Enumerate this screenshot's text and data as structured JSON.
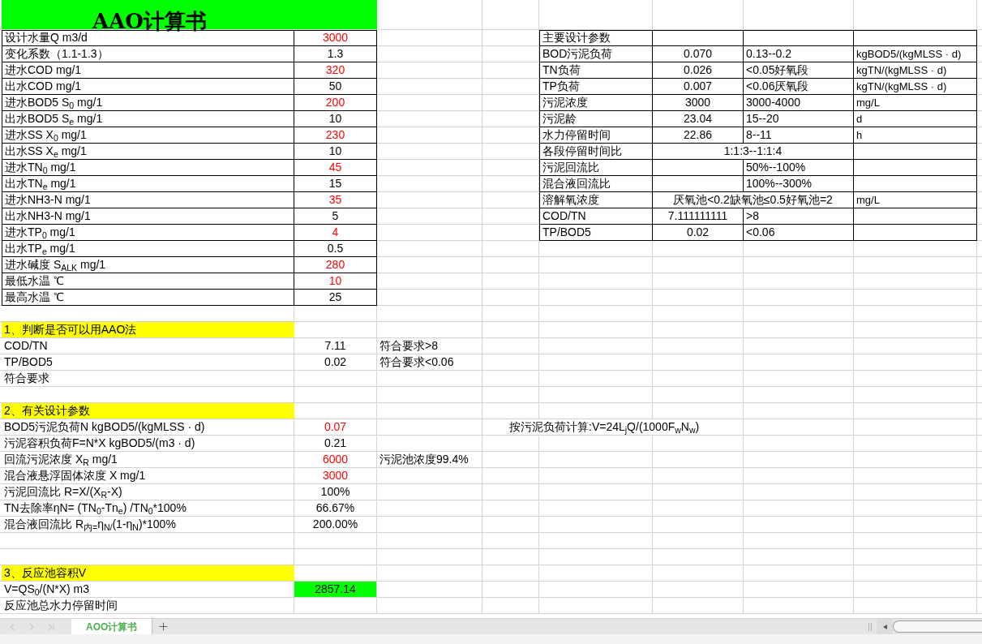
{
  "title": "AAO计算书",
  "input_table": [
    {
      "label": "设计水量Q m3/d",
      "value": "3000",
      "color": "#ff0000"
    },
    {
      "label": "变化系数（1.1-1.3）",
      "value": "1.3",
      "color": "#000000"
    },
    {
      "label": "进水COD mg/1",
      "value": "320",
      "color": "#ff0000"
    },
    {
      "label": "出水COD mg/1",
      "value": "50",
      "color": "#000000"
    },
    {
      "label": "进水BOD5 S$_{0}$ mg/1",
      "value": "200",
      "color": "#ff0000"
    },
    {
      "label": "出水BOD5 S$_{e}$ mg/1",
      "value": "10",
      "color": "#000000"
    },
    {
      "label": "进水SS X$_{0}$ mg/1",
      "value": "230",
      "color": "#ff0000"
    },
    {
      "label": "出水SS X$_{e}$ mg/1",
      "value": "10",
      "color": "#000000"
    },
    {
      "label": "进水TN$_{0}$ mg/1",
      "value": "45",
      "color": "#ff0000"
    },
    {
      "label": "出水TN$_{e}$ mg/1",
      "value": "15",
      "color": "#000000"
    },
    {
      "label": "进水NH3-N mg/1",
      "value": "35",
      "color": "#ff0000"
    },
    {
      "label": "出水NH3-N mg/1",
      "value": "5",
      "color": "#000000"
    },
    {
      "label": "进水TP$_{0}$ mg/1",
      "value": "4",
      "color": "#ff0000"
    },
    {
      "label": "出水TP$_{e}$ mg/1",
      "value": "0.5",
      "color": "#000000"
    },
    {
      "label": "进水碱度 S$_{ALK}$ mg/1",
      "value": "280",
      "color": "#ff0000"
    },
    {
      "label": "最低水温 ℃",
      "value": "10",
      "color": "#ff0000"
    },
    {
      "label": "最高水温 ℃",
      "value": "25",
      "color": "#000000"
    }
  ],
  "params_table": {
    "header": "主要设计参数",
    "rows": [
      {
        "kind": "normal",
        "name": "BOD污泥负荷",
        "value": "0.070",
        "range": "0.13--0.2",
        "unit": "kgBOD5/(kgMLSS · d)"
      },
      {
        "kind": "normal",
        "name": "TN负荷",
        "value": "0.026",
        "range": "<0.05好氧段",
        "unit": "kgTN/(kgMLSS · d)"
      },
      {
        "kind": "normal",
        "name": "TP负荷",
        "value": "0.007",
        "range": "<0.06厌氧段",
        "unit": "kgTN/(kgMLSS · d)"
      },
      {
        "kind": "normal",
        "name": "污泥浓度",
        "value": "3000",
        "range": "3000-4000",
        "unit": "mg/L"
      },
      {
        "kind": "normal",
        "name": "污泥龄",
        "value": "23.04",
        "range": "15--20",
        "unit": "d"
      },
      {
        "kind": "normal",
        "name": "水力停留时间",
        "value": "22.86",
        "range": "8--11",
        "unit": "h"
      },
      {
        "kind": "merged",
        "name": "各段停留时间比",
        "value": "1:1:3--1:1:4"
      },
      {
        "kind": "normal",
        "name": "污泥回流比",
        "range": "50%--100%"
      },
      {
        "kind": "normal",
        "name": "混合液回流比",
        "range": "100%--300%"
      },
      {
        "kind": "merged",
        "name": "溶解氧浓度",
        "value": "厌氧池<0.2缺氧池≤0.5好氧池=2",
        "unit": "mg/L"
      },
      {
        "kind": "normal",
        "name": "COD/TN",
        "value": "7.111111111",
        "range": ">8"
      },
      {
        "kind": "normal",
        "name": "TP/BOD5",
        "value": "0.02",
        "range": "<0.06"
      }
    ]
  },
  "sections": [
    {
      "heading": "1、判断是否可以用AAO法",
      "rows": [
        {
          "label": "COD/TN",
          "value": "7.11",
          "color": "#000000",
          "note": "符合要求>8"
        },
        {
          "label": "TP/BOD5",
          "value": "0.02",
          "color": "#000000",
          "note": "符合要求<0.06"
        },
        {
          "label": "符合要求"
        }
      ]
    },
    {
      "heading": "2、有关设计参数",
      "rows": [
        {
          "label": "BOD5污泥负荷N kgBOD5/(kgMLSS · d)",
          "value": "0.07",
          "color": "#ff0000",
          "formula": "按污泥负荷计算:V=24L$_{j}$Q/(1000F$_{w}$N$_{w}$)"
        },
        {
          "label": "污泥容积负荷F=N*X kgBOD5/(m3 · d)",
          "value": "0.21",
          "color": "#000000"
        },
        {
          "label": "回流污泥浓度 X$_{R}$ mg/1",
          "value": "6000",
          "color": "#ff0000",
          "note": "污泥池浓度99.4%"
        },
        {
          "label": "混合液悬浮固体浓度 X  mg/1",
          "value": "3000",
          "color": "#ff0000"
        },
        {
          "label": "污泥回流比 R=X/(X$_{R}$-X)",
          "value": "100%",
          "color": "#000000"
        },
        {
          "label": "TN去除率ηN= (TN$_{0}$-Tn$_{e}$) /TN$_{0}$*100%",
          "value": "66.67%",
          "color": "#000000"
        },
        {
          "label": "混合液回流比 R$_{内=}$η$_{N/}$(1-η$_{N}$)*100%",
          "value": "200.00%",
          "color": "#000000"
        }
      ]
    },
    {
      "heading": "3、反应池容积V",
      "rows": [
        {
          "label": "V=QS$_{0}$/(N*X)  m3",
          "value": "2857.14",
          "highlight": true
        },
        {
          "label": "反应池总水力停留时间"
        }
      ]
    }
  ],
  "sheet_tabs": [
    {
      "label": "AOO计算书",
      "selected": true
    }
  ]
}
